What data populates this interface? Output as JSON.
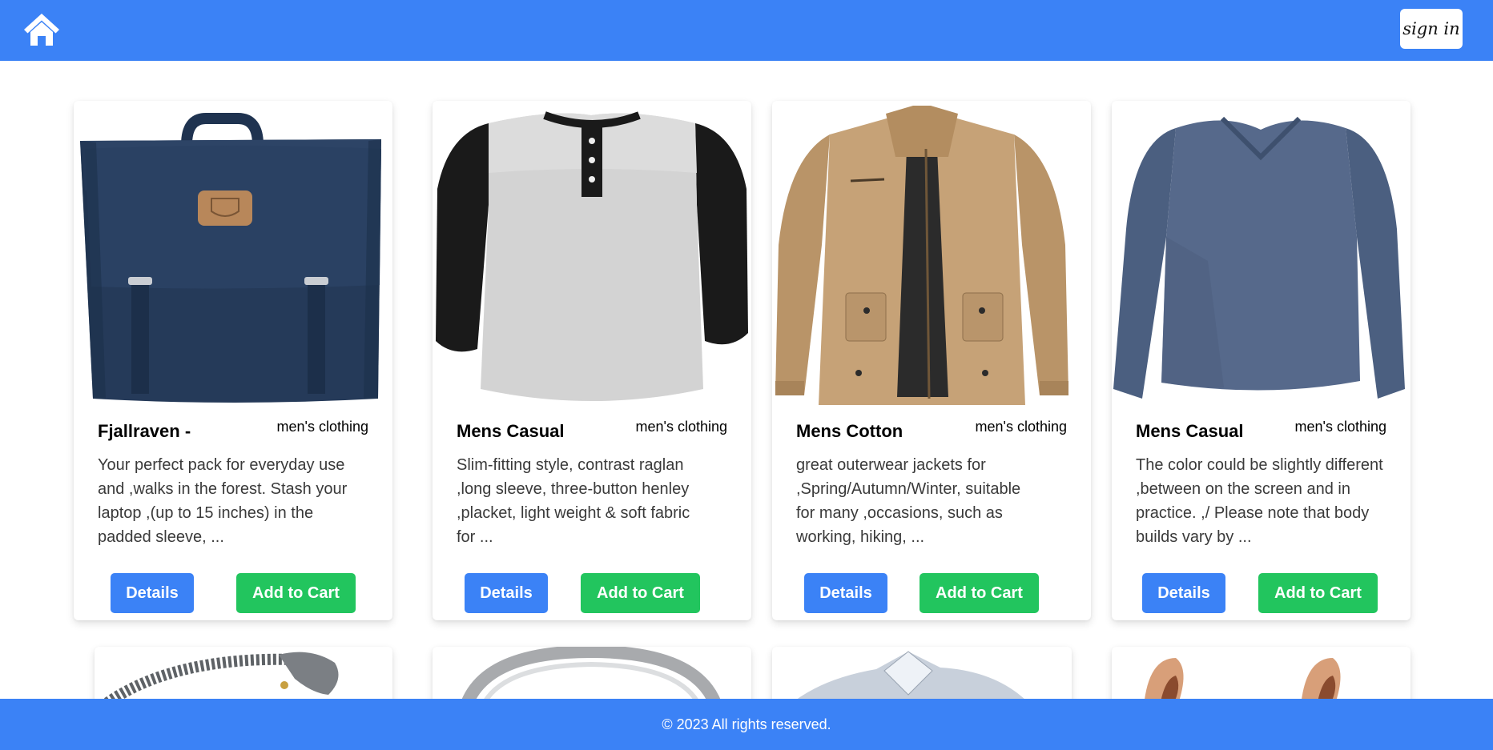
{
  "header": {
    "home_icon": "home-icon",
    "signin_label": "sign in",
    "bg_color": "#3b82f6"
  },
  "products": [
    {
      "title": "Fjallraven -",
      "category": "men's clothing",
      "description": "Your perfect pack for everyday use\nand ,walks in the forest. Stash your\nlaptop ,(up to 15 inches) in the\npadded sleeve, ...",
      "details_label": "Details",
      "cart_label": "Add to Cart",
      "image": "backpack-image"
    },
    {
      "title": "Mens Casual",
      "category": "men's clothing",
      "description": "Slim-fitting style, contrast raglan\n,long sleeve, three-button henley\n,placket, light weight & soft fabric\nfor ...",
      "details_label": "Details",
      "cart_label": "Add to Cart",
      "image": "raglan-henley-image"
    },
    {
      "title": "Mens Cotton",
      "category": "men's clothing",
      "description": "great outerwear jackets for\n,Spring/Autumn/Winter, suitable\nfor many ,occasions, such as\nworking, hiking, ...",
      "details_label": "Details",
      "cart_label": "Add to Cart",
      "image": "cotton-jacket-image"
    },
    {
      "title": "Mens Casual",
      "category": "men's clothing",
      "description": "The color could be slightly different\n,between on the screen and in\npractice. ,/ Please note that body\nbuilds vary by ...",
      "details_label": "Details",
      "cart_label": "Add to Cart",
      "image": "long-sleeve-tee-image"
    }
  ],
  "partial_products": [
    {
      "image": "dragon-bracelet-image"
    },
    {
      "image": "silver-ring-image"
    },
    {
      "image": "diamond-ring-image"
    },
    {
      "image": "rose-gold-earrings-image"
    }
  ],
  "footer": {
    "text": "© 2023 All rights reserved."
  },
  "colors": {
    "primary": "#3b82f6",
    "success": "#22c55e"
  }
}
